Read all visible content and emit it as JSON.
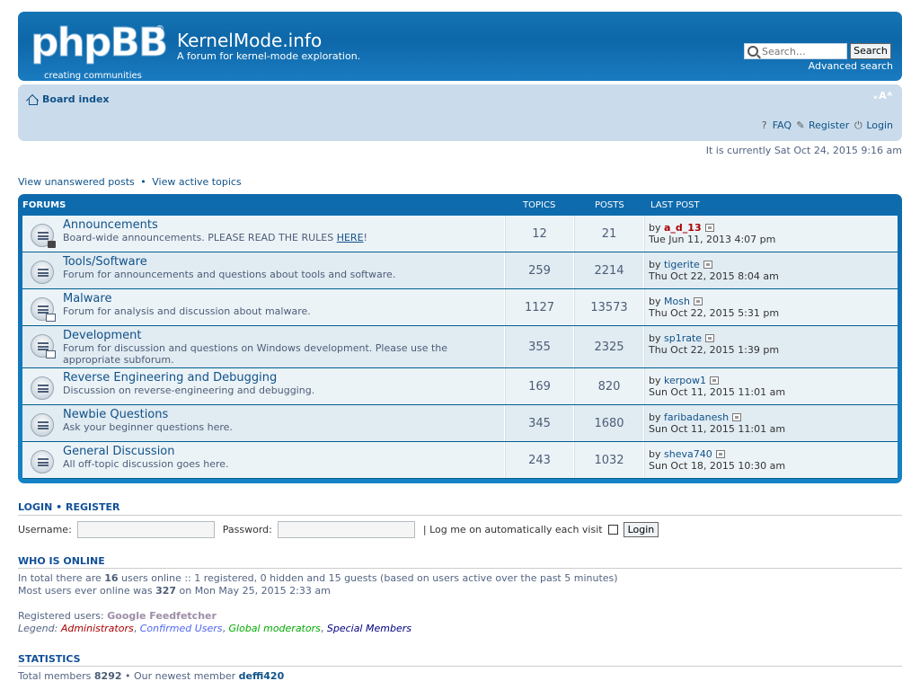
{
  "header": {
    "logo_text": "phpBB",
    "logo_sub": "creating  communities",
    "site_title": "KernelMode.info",
    "site_desc": "A forum for kernel-mode exploration.",
    "search_placeholder": "Search…",
    "search_button": "Search",
    "advanced_search": "Advanced search"
  },
  "navbar": {
    "board_index": "Board index",
    "font_resize": "ᵥAᴬ",
    "faq": "FAQ",
    "register": "Register",
    "login": "Login"
  },
  "current_time": "It is currently Sat Oct 24, 2015 9:16 am",
  "quick_links": {
    "unanswered": "View unanswered posts",
    "sep": "•",
    "active": "View active topics"
  },
  "forum_table": {
    "headers": {
      "forums": "FORUMS",
      "topics": "TOPICS",
      "posts": "POSTS",
      "last_post": "LAST POST"
    },
    "rows": [
      {
        "title": "Announcements",
        "desc_pre": "Board-wide announcements. PLEASE READ THE RULES ",
        "desc_link": "HERE",
        "desc_post": "!",
        "topics": "12",
        "posts": "21",
        "by": "by",
        "user": "a_d_13",
        "date": "Tue Jun 11, 2013 4:07 pm",
        "icon": "locked-forum-icon"
      },
      {
        "title": "Tools/Software",
        "desc": "Forum for announcements and questions about tools and software.",
        "topics": "259",
        "posts": "2214",
        "by": "by",
        "user": "tigerite",
        "date": "Thu Oct 22, 2015 8:04 am",
        "icon": "forum-read-icon"
      },
      {
        "title": "Malware",
        "desc": "Forum for analysis and discussion about malware.",
        "topics": "1127",
        "posts": "13573",
        "by": "by",
        "user": "Mosh",
        "date": "Thu Oct 22, 2015 5:31 pm",
        "icon": "forum-subforum-icon"
      },
      {
        "title": "Development",
        "desc": "Forum for discussion and questions on Windows development. Please use the appropriate subforum.",
        "topics": "355",
        "posts": "2325",
        "by": "by",
        "user": "sp1rate",
        "date": "Thu Oct 22, 2015 1:39 pm",
        "icon": "forum-subforum-icon"
      },
      {
        "title": "Reverse Engineering and Debugging",
        "desc": "Discussion on reverse-engineering and debugging.",
        "topics": "169",
        "posts": "820",
        "by": "by",
        "user": "kerpow1",
        "date": "Sun Oct 11, 2015 11:01 am",
        "icon": "forum-read-icon"
      },
      {
        "title": "Newbie Questions",
        "desc": "Ask your beginner questions here.",
        "topics": "345",
        "posts": "1680",
        "by": "by",
        "user": "faribadanesh",
        "date": "Sun Oct 11, 2015 11:01 am",
        "icon": "forum-read-icon"
      },
      {
        "title": "General Discussion",
        "desc": "All off-topic discussion goes here.",
        "topics": "243",
        "posts": "1032",
        "by": "by",
        "user": "sheva740",
        "date": "Sun Oct 18, 2015 10:30 am",
        "icon": "forum-read-icon"
      }
    ]
  },
  "login": {
    "title": "LOGIN  •  REGISTER",
    "username_label": "Username:",
    "password_label": "Password:",
    "remember_label": "| Log me on automatically each visit",
    "button": "Login"
  },
  "online": {
    "title": "WHO IS ONLINE",
    "line1_pre": "In total there are ",
    "line1_count": "16",
    "line1_post": " users online :: 1 registered, 0 hidden and 15 guests (based on users active over the past 5 minutes)",
    "line2_pre": "Most users ever online was ",
    "line2_count": "327",
    "line2_post": " on Mon May 25, 2015 2:33 am",
    "registered_label": "Registered users: ",
    "registered_user": "Google Feedfetcher",
    "legend_label": "Legend: ",
    "legend": [
      "Administrators",
      "Confirmed Users",
      "Global moderators",
      "Special Members"
    ]
  },
  "statistics": {
    "title": "STATISTICS",
    "total_pre": "Total members ",
    "total_count": "8292",
    "newest_pre": " • Our newest member ",
    "newest_user": "deffi420"
  },
  "colors": {
    "header_blue": "#0d67a8",
    "navbar_bg": "#cadceb",
    "row_bg": "#ecf3f7",
    "row_alt_bg": "#e1ebf2",
    "admin_red": "#aa0000"
  }
}
